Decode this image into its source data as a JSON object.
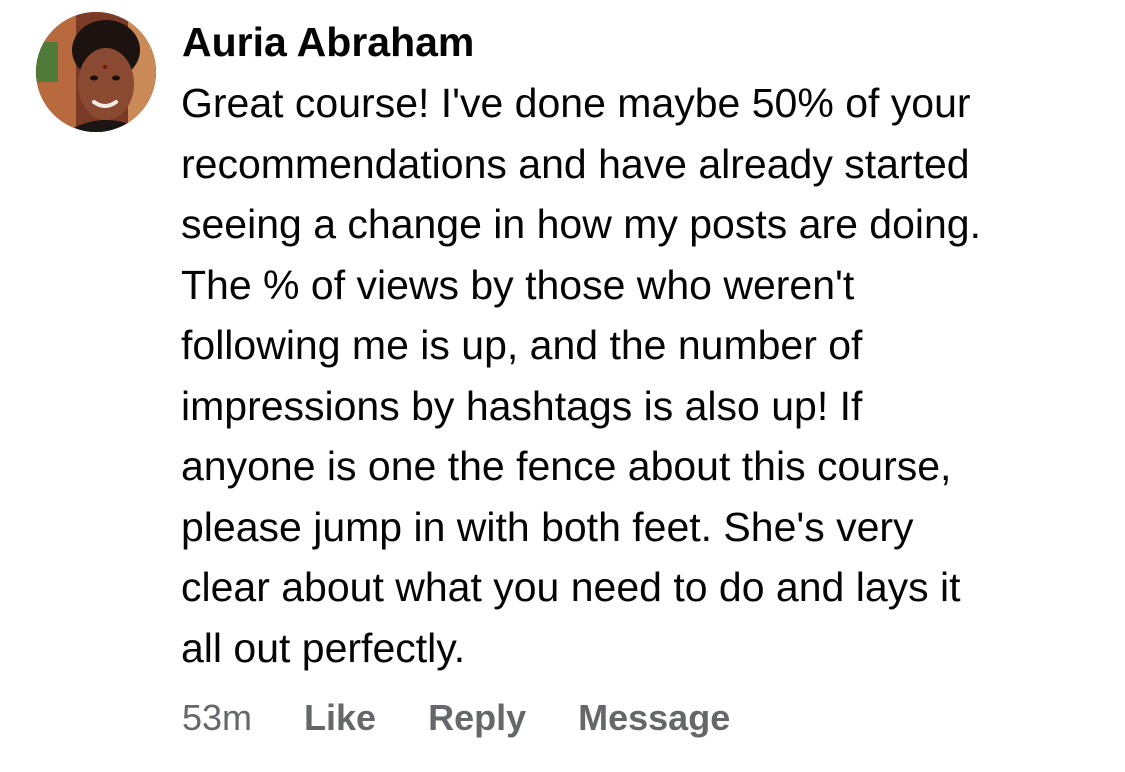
{
  "comment": {
    "author": "Auria Abraham",
    "text": "Great course!  I've done maybe 50% of your\nrecommendations and have already started\nseeing a change in how my posts are doing.\nThe % of views by those who weren't\nfollowing me is up, and the number of\nimpressions by hashtags is also up!  If\nanyone is one the fence about this course,\nplease jump in with both feet.  She's very\nclear about what you need to do and lays it\nall out perfectly.",
    "timestamp": "53m",
    "actions": {
      "like": "Like",
      "reply": "Reply",
      "message": "Message"
    }
  },
  "colors": {
    "text_primary": "#050505",
    "text_secondary": "#65676b",
    "background": "#ffffff"
  }
}
